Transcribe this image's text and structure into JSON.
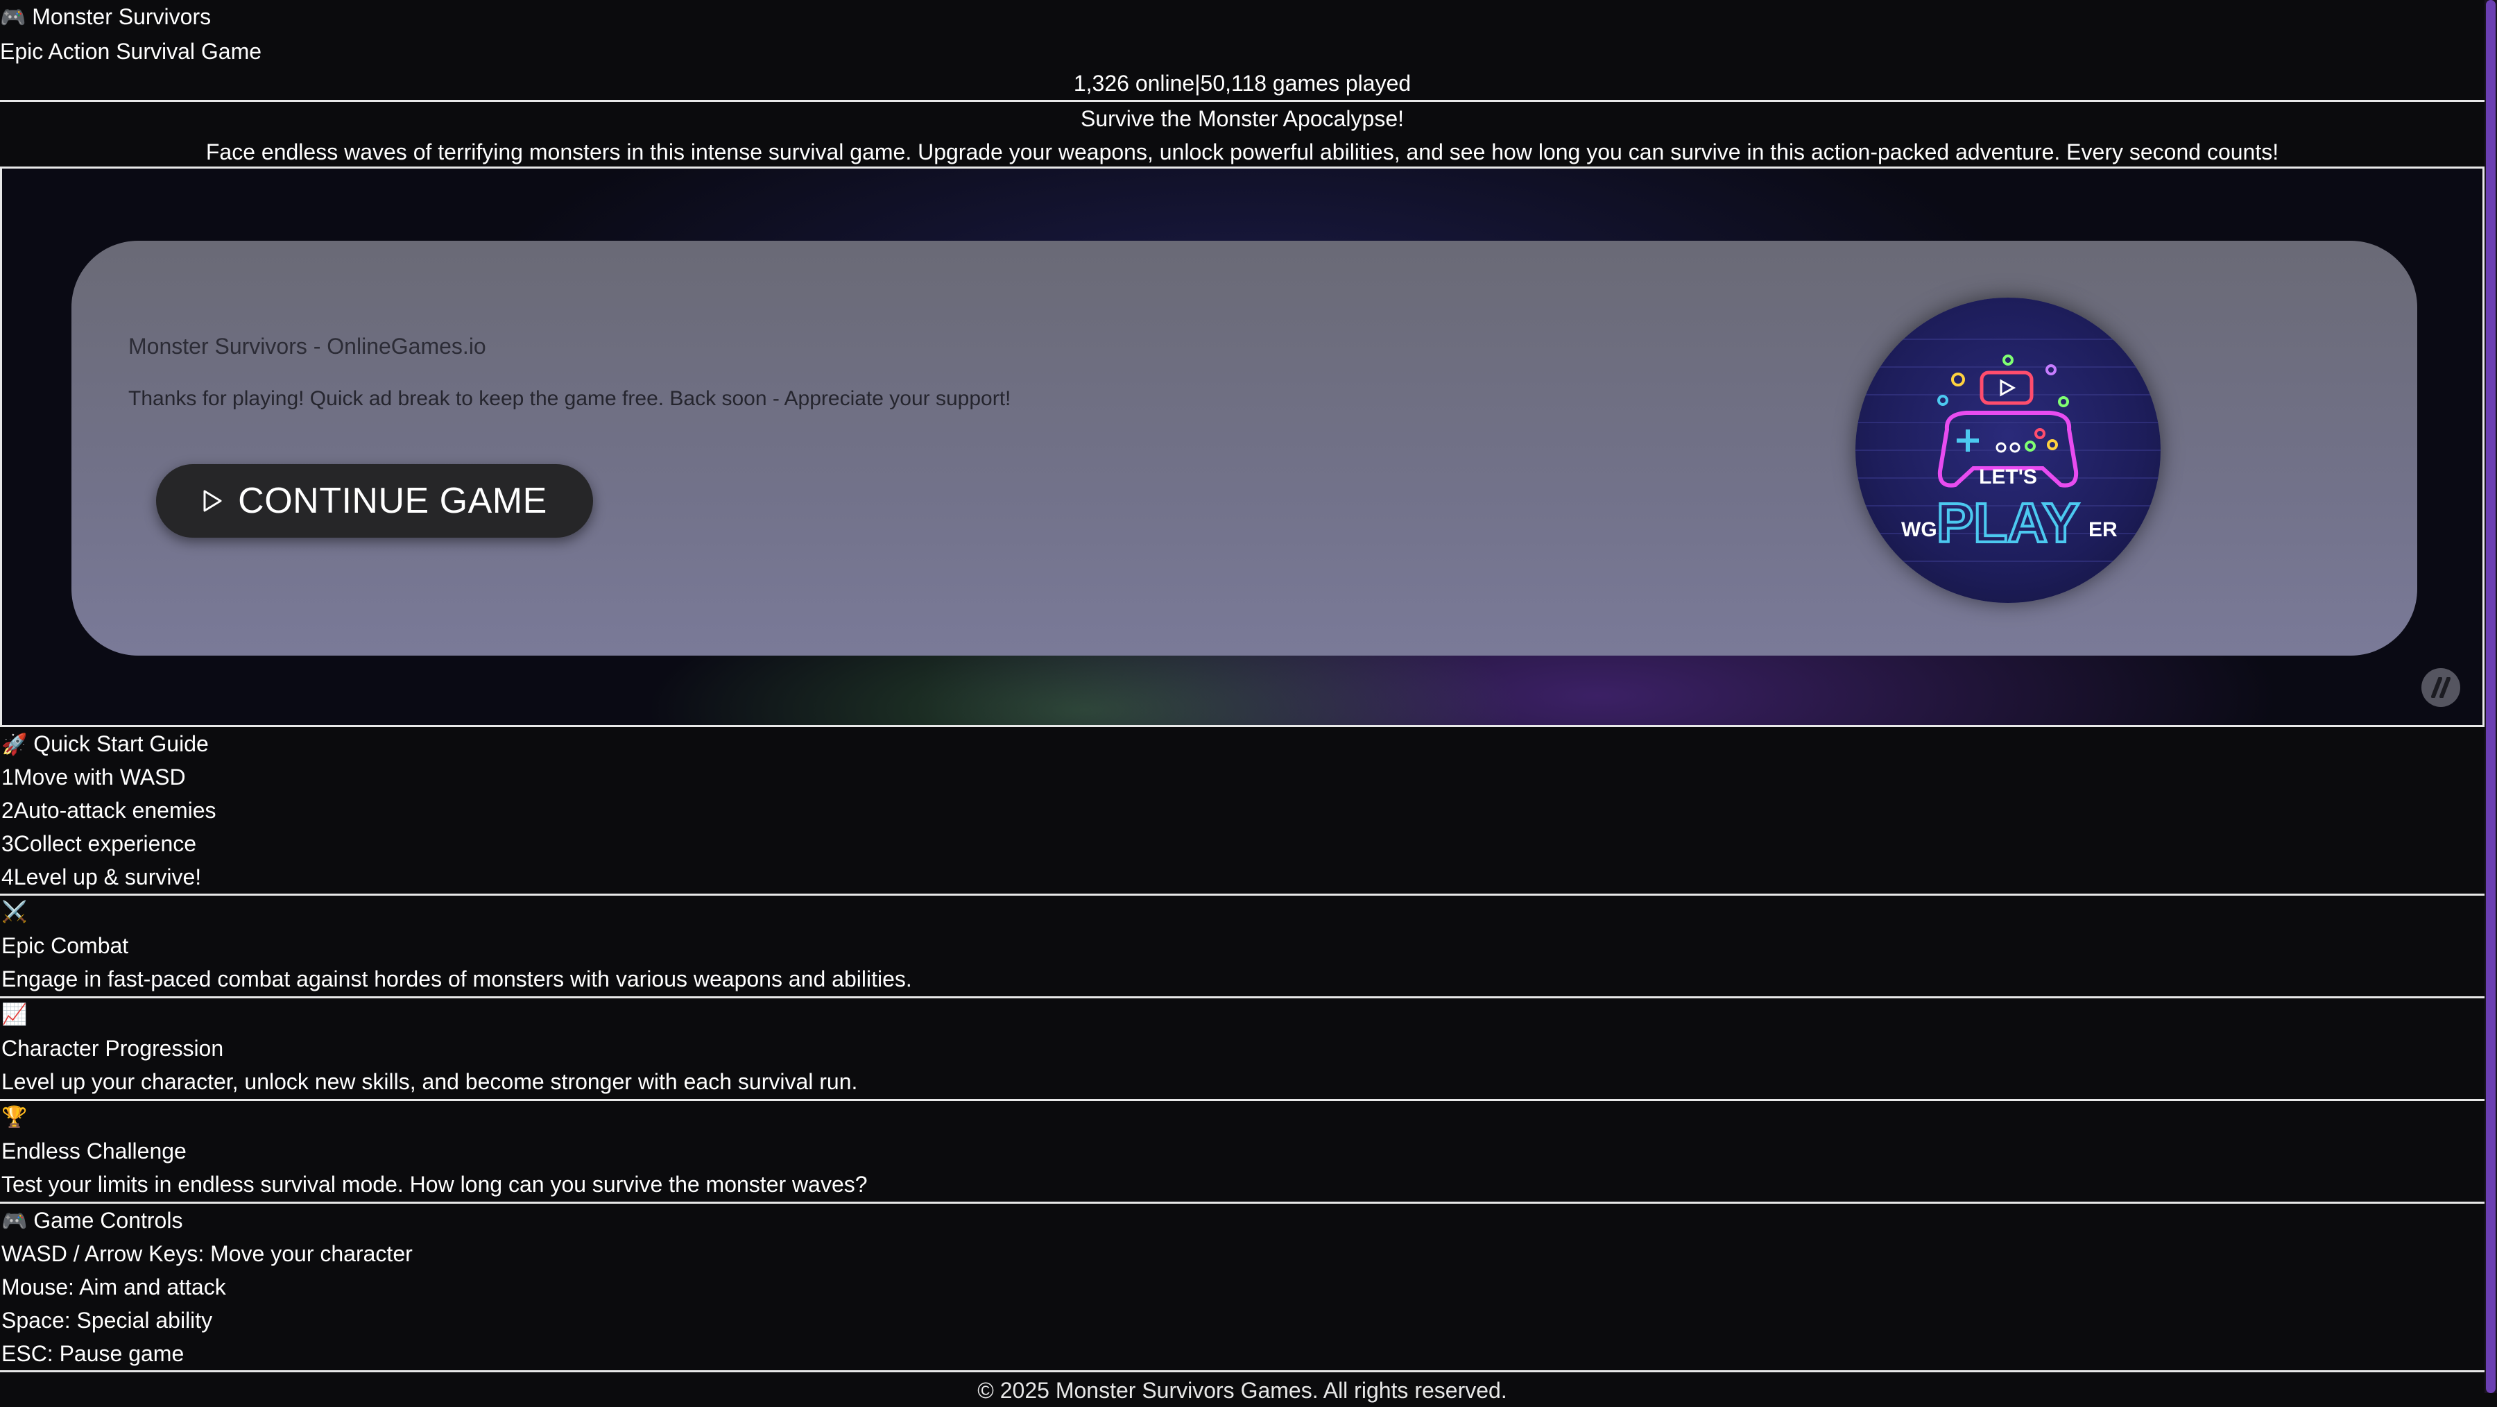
{
  "header": {
    "title_icon": "🎮",
    "title": "Monster Survivors",
    "subtitle": "Epic Action Survival Game"
  },
  "stats": {
    "online": "1,326 online",
    "separator": "|",
    "games_played": "50,118 games played"
  },
  "hero": {
    "title": "Survive the Monster Apocalypse!",
    "description": "Face endless waves of terrifying monsters in this intense survival game. Upgrade your weapons, unlock powerful abilities, and see how long you can survive in this action-packed adventure. Every second counts!"
  },
  "ad": {
    "source": "Monster Survivors - OnlineGames.io",
    "message": "Thanks for playing! Quick ad break to keep the game free. Back soon - Appreciate your support!",
    "continue_label": "CONTINUE GAME",
    "logo": {
      "line1": "LET'S",
      "prefix": "WG",
      "main": "PLAY",
      "suffix": "ER"
    }
  },
  "quick_start": {
    "icon": "🚀",
    "title": "Quick Start Guide",
    "steps": [
      {
        "num": "1",
        "text": "Move with WASD"
      },
      {
        "num": "2",
        "text": "Auto-attack enemies"
      },
      {
        "num": "3",
        "text": "Collect experience"
      },
      {
        "num": "4",
        "text": "Level up & survive!"
      }
    ]
  },
  "features": [
    {
      "icon": "⚔️",
      "title": "Epic Combat",
      "text": "Engage in fast-paced combat against hordes of monsters with various weapons and abilities."
    },
    {
      "icon": "📈",
      "title": "Character Progression",
      "text": "Level up your character, unlock new skills, and become stronger with each survival run."
    },
    {
      "icon": "🏆",
      "title": "Endless Challenge",
      "text": "Test your limits in endless survival mode. How long can you survive the monster waves?"
    }
  ],
  "controls": {
    "icon": "🎮",
    "title": "Game Controls",
    "items": [
      "WASD / Arrow Keys: Move your character",
      "Mouse: Aim and attack",
      "Space: Special ability",
      "ESC: Pause game"
    ]
  },
  "footer": {
    "text": "© 2025 Monster Survivors Games. All rights reserved."
  },
  "colors": {
    "background": "#0b0b0d",
    "divider": "#e8e8e8",
    "accent": "#6b3fb3",
    "button": "#262628"
  }
}
